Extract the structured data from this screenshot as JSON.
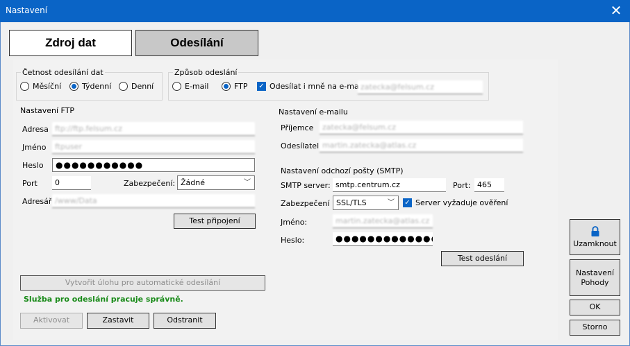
{
  "window": {
    "title": "Nastavení",
    "close_glyph": "✕"
  },
  "tabs": [
    {
      "label": "Zdroj dat",
      "active": false
    },
    {
      "label": "Odesílání",
      "active": true
    }
  ],
  "frequency": {
    "legend": "Četnost odesílání dat",
    "options": [
      {
        "label": "Měsíční",
        "selected": false
      },
      {
        "label": "Týdenní",
        "selected": true
      },
      {
        "label": "Denní",
        "selected": false
      }
    ]
  },
  "send_method": {
    "legend": "Způsob odeslání",
    "options": [
      {
        "label": "E-mail",
        "selected": false
      },
      {
        "label": "FTP",
        "selected": true
      }
    ],
    "also_email_label": "Odesílat i mně na e-mail",
    "also_email_checked": true,
    "also_email_value": "zatecka@felsum.cz"
  },
  "ftp": {
    "title": "Nastavení FTP",
    "address_label": "Adresa",
    "address_value": "ftp://ftp.felsum.cz",
    "name_label": "Jméno",
    "name_value": "ftpuser",
    "password_label": "Heslo",
    "password_value": "●●●●●●●●●●●",
    "port_label": "Port",
    "port_value": "0",
    "security_label": "Zabezpečení:",
    "security_value": "Žádné",
    "folder_label": "Adresář",
    "folder_value": "/www/Data",
    "test_button": "Test připojení"
  },
  "email": {
    "title": "Nastavení e-mailu",
    "recipient_label": "Příjemce",
    "recipient_value": "zatecka@felsum.cz",
    "sender_label": "Odesílatel",
    "sender_value": "martin.zatecka@atlas.cz"
  },
  "smtp": {
    "title": "Nastavení odchozí pošty (SMTP)",
    "server_label": "SMTP server:",
    "server_value": "smtp.centrum.cz",
    "port_label": "Port:",
    "port_value": "465",
    "security_label": "Zabezpečení",
    "security_value": "SSL/TLS",
    "auth_label": "Server vyžaduje ověření",
    "auth_checked": true,
    "name_label": "Jméno:",
    "name_value": "martin.zatecka@atlas.cz",
    "password_label": "Heslo:",
    "password_value": "●●●●●●●●●●●●●●●",
    "test_button": "Test odeslání"
  },
  "task_button": "Vytvořit úlohu pro automatické odesílání",
  "status_text": "Služba pro odeslání pracuje správně.",
  "service_buttons": {
    "activate": "Aktivovat",
    "stop": "Zastavit",
    "remove": "Odstranit"
  },
  "side_buttons": {
    "lock_label": "Uzamknout",
    "lock_icon": "lock-icon",
    "pohoda_line1": "Nastavení",
    "pohoda_line2": "Pohody",
    "ok": "OK",
    "cancel": "Storno"
  },
  "colors": {
    "accent": "#0a64c6",
    "status_ok": "#188a18"
  }
}
